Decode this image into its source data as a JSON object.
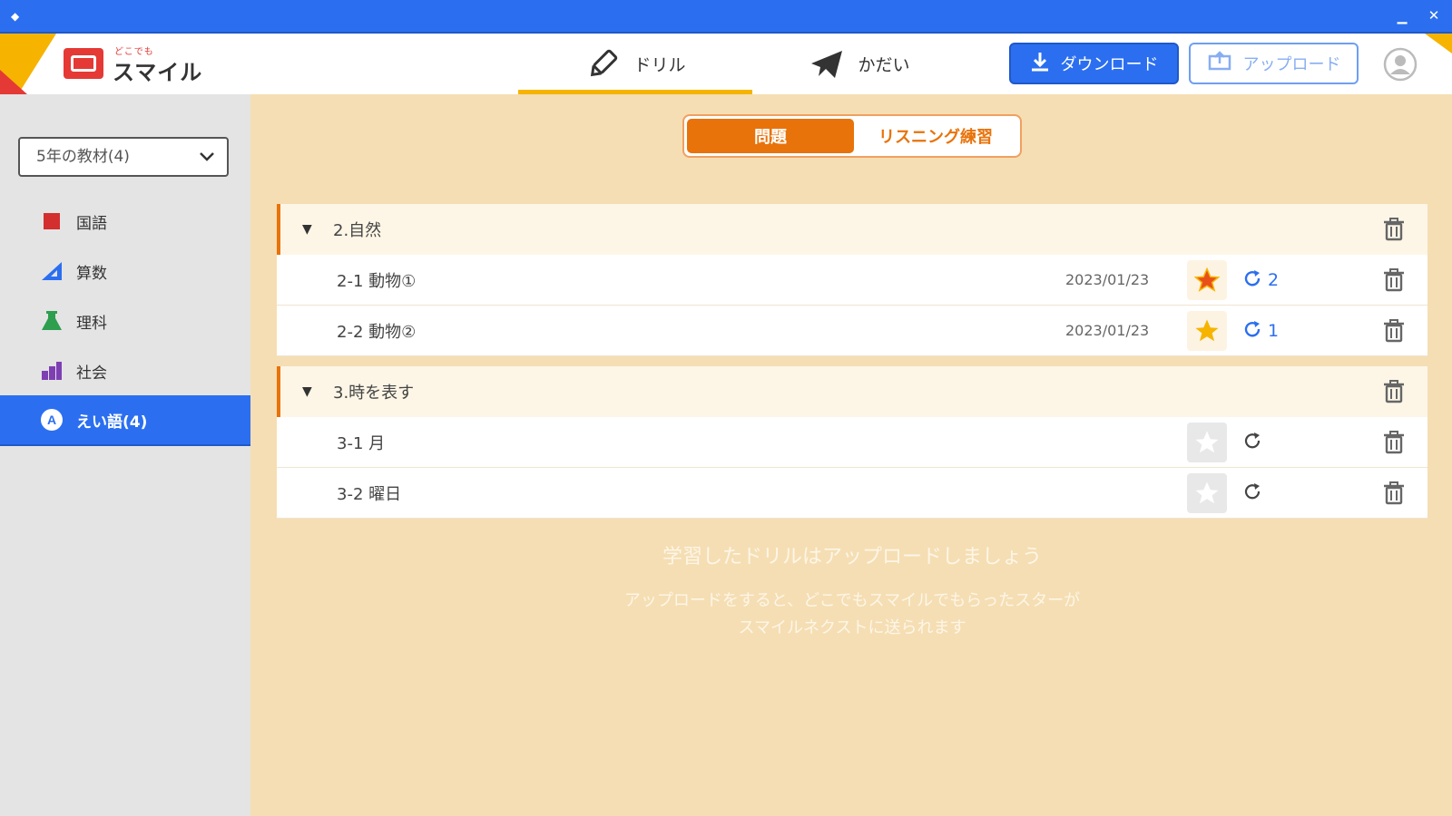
{
  "colors": {
    "primary_blue": "#2b6ff0",
    "orange": "#e8730a",
    "content_bg": "#f5deb3",
    "sidebar_bg": "#e4e4e4",
    "nav_underline": "#f6b400"
  },
  "app": {
    "logo_small": "どこでも",
    "logo_main": "スマイル"
  },
  "nav": {
    "drill_label": "ドリル",
    "task_label": "かだい",
    "download_label": "ダウンロード",
    "upload_label": "アップロード"
  },
  "sidebar": {
    "material_select": "5年の教材(4)",
    "subjects": [
      {
        "label": "国語",
        "icon": "book-icon"
      },
      {
        "label": "算数",
        "icon": "triangle-ruler-icon"
      },
      {
        "label": "理科",
        "icon": "flask-icon"
      },
      {
        "label": "社会",
        "icon": "buildings-icon"
      },
      {
        "label": "えい語(4)",
        "icon": "english-icon",
        "active": true
      }
    ]
  },
  "segment": {
    "active_label": "問題",
    "inactive_label": "リスニング練習"
  },
  "units": [
    {
      "title": "2.自然",
      "items": [
        {
          "title": "2-1 動物①",
          "date": "2023/01/23",
          "star": "red-star",
          "retry_count": "2"
        },
        {
          "title": "2-2 動物②",
          "date": "2023/01/23",
          "star": "gold-star",
          "retry_count": "1"
        }
      ]
    },
    {
      "title": "3.時を表す",
      "items": [
        {
          "title": "3-1 月",
          "date": "",
          "star": "empty-star",
          "retry_count": ""
        },
        {
          "title": "3-2 曜日",
          "date": "",
          "star": "empty-star",
          "retry_count": ""
        }
      ]
    }
  ],
  "message": {
    "title": "学習したドリルはアップロードしましょう",
    "line1": "アップロードをすると、どこでもスマイルでもらったスターが",
    "line2": "スマイルネクストに送られます"
  }
}
